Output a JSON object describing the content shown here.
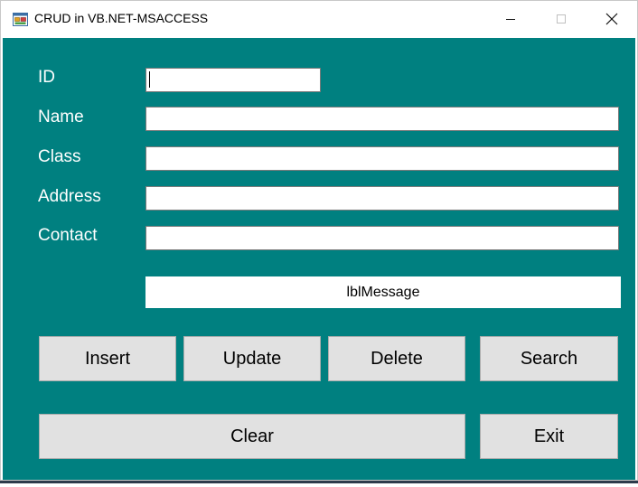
{
  "window": {
    "title": "CRUD in VB.NET-MSACCESS",
    "icon": "form-icon",
    "controls": {
      "minimize": "─",
      "maximize": "☐",
      "close": "✕"
    }
  },
  "form": {
    "labels": {
      "id": "ID",
      "name": "Name",
      "class": "Class",
      "address": "Address",
      "contact": "Contact"
    },
    "values": {
      "id": "",
      "name": "",
      "class": "",
      "address": "",
      "contact": ""
    },
    "message": "lblMessage"
  },
  "buttons": {
    "insert": "Insert",
    "update": "Update",
    "delete": "Delete",
    "search": "Search",
    "clear": "Clear",
    "exit": "Exit"
  },
  "colors": {
    "form_background": "#008080",
    "button_face": "#e1e1e1",
    "label_text": "#ffffff"
  }
}
